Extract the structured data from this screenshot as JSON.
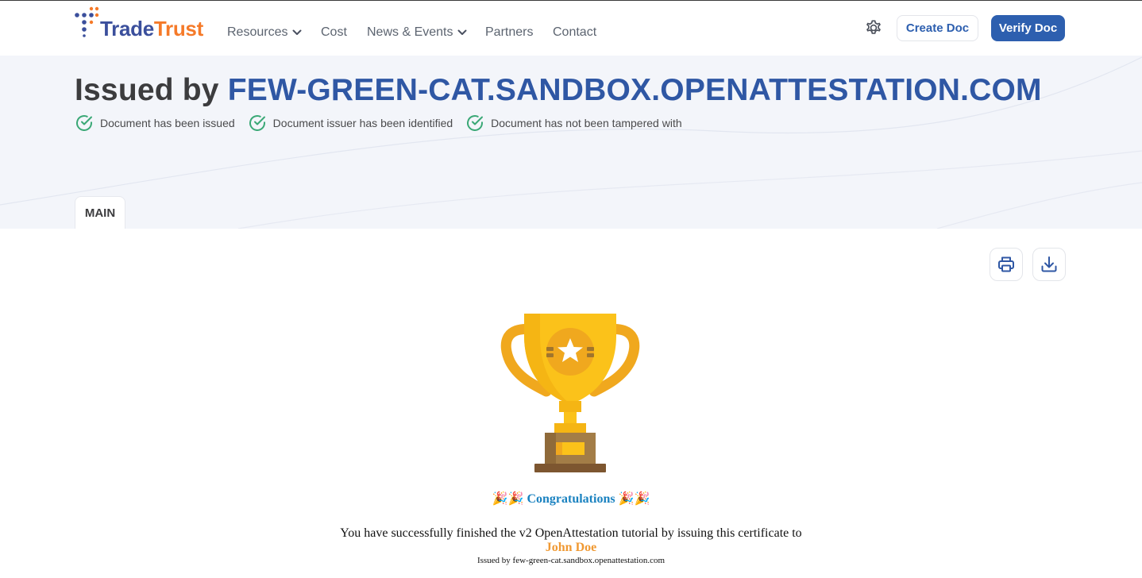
{
  "brand": {
    "name_part1": "Trade",
    "name_part2": "Trust",
    "colors": {
      "primary": "#2f57a4",
      "accent": "#f57a29",
      "success": "#3aa876"
    }
  },
  "nav": {
    "items": [
      {
        "label": "Resources",
        "has_dropdown": true
      },
      {
        "label": "Cost",
        "has_dropdown": false
      },
      {
        "label": "News & Events",
        "has_dropdown": true
      },
      {
        "label": "Partners",
        "has_dropdown": false
      },
      {
        "label": "Contact",
        "has_dropdown": false
      }
    ],
    "settings_icon": "gear-icon",
    "create_doc_label": "Create Doc",
    "verify_doc_label": "Verify Doc"
  },
  "status": {
    "issued_prefix": "Issued by",
    "issuer_domain": "FEW-GREEN-CAT.SANDBOX.OPENATTESTATION.COM",
    "checks": [
      "Document has been issued",
      "Document issuer has been identified",
      "Document has not been tampered with"
    ],
    "check_icon": "check-circle-icon"
  },
  "tabs": [
    {
      "label": "MAIN",
      "active": true
    }
  ],
  "toolbar": {
    "print_icon": "printer-icon",
    "download_icon": "download-icon"
  },
  "certificate": {
    "image": "trophy-icon",
    "congrats_emoji": "🎉🎉",
    "congrats_text": "Congratulations",
    "message": "You have successfully finished the v2 OpenAttestation tutorial by issuing this certificate to",
    "recipient": "John Doe",
    "issued_by_line": "Issued by few-green-cat.sandbox.openattestation.com"
  }
}
